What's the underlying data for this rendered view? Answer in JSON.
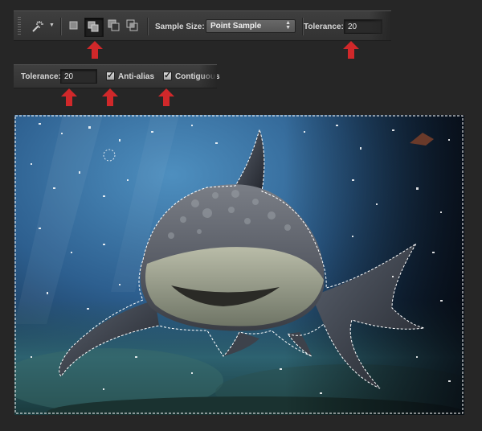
{
  "options_bar": {
    "tool_icon": "magic-wand-icon",
    "selection_modes": [
      "new-selection-icon",
      "add-to-selection-icon",
      "subtract-from-selection-icon",
      "intersect-with-selection-icon"
    ],
    "sample_size_label": "Sample Size:",
    "sample_size_value": "Point Sample",
    "tolerance_label": "Tolerance:",
    "tolerance_value": "20"
  },
  "options_bar_zoom": {
    "tolerance_label": "Tolerance:",
    "tolerance_value": "20",
    "anti_alias_label": "Anti-alias",
    "anti_alias_checked": true,
    "contiguous_label": "Contiguous",
    "contiguous_checked": true
  },
  "colors": {
    "annotation_arrow": "#d0282a",
    "background": "#262626"
  }
}
